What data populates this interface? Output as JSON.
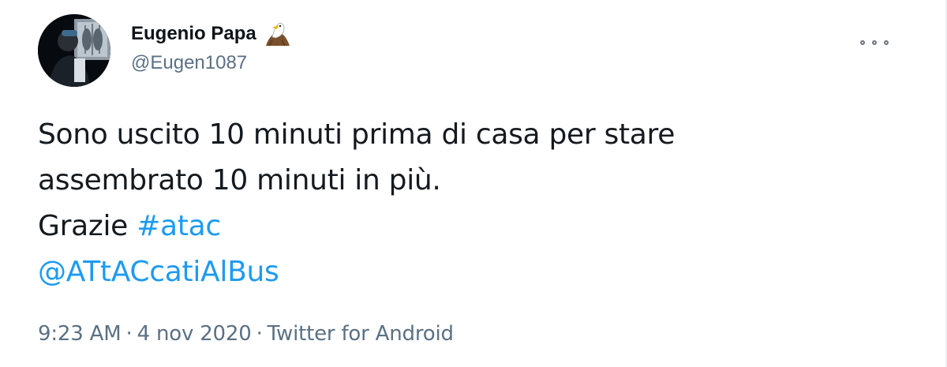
{
  "author": {
    "display_name": "Eugenio Papa",
    "handle": "@Eugen1087",
    "badge_icon": "eagle-emoji-icon"
  },
  "tweet": {
    "line1": "Sono uscito 10 minuti prima di casa per stare",
    "line2": "assembrato 10 minuti in più.",
    "line3_text": "Grazie ",
    "hashtag": "#atac",
    "mention": "@ATtACcatiAlBus"
  },
  "meta": {
    "time": "9:23 AM",
    "date": "4 nov 2020",
    "separator": "·",
    "source": "Twitter for Android"
  },
  "colors": {
    "link": "#1d9bf0",
    "secondary_text": "#5b7083",
    "primary_text": "#0f1419"
  }
}
